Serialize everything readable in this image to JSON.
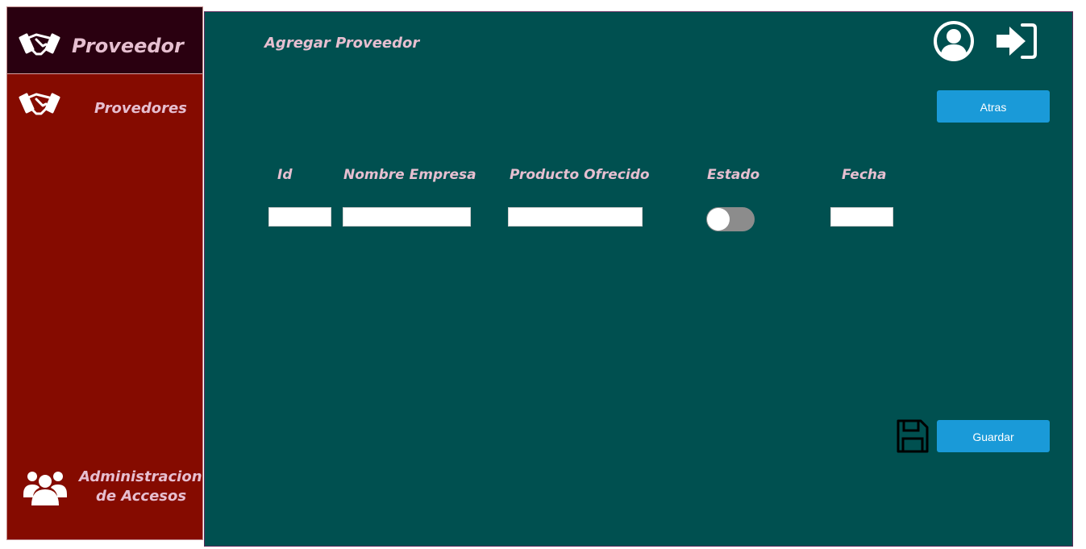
{
  "sidebar": {
    "title": "Proveedor",
    "items": [
      {
        "label": "Provedores",
        "icon": "handshake-icon"
      },
      {
        "label_line1": "Administracion",
        "label_line2": "de Accesos",
        "icon": "users-icon"
      }
    ]
  },
  "header": {
    "title": "Agregar Proveedor",
    "icons": [
      "user-avatar-icon",
      "sign-in-icon"
    ]
  },
  "buttons": {
    "back_label": "Atras",
    "save_label": "Guardar"
  },
  "form": {
    "columns": [
      "Id",
      "Nombre Empresa",
      "Producto Ofrecido",
      "Estado",
      "Fecha"
    ],
    "values": {
      "id": "",
      "nombre_empresa": "",
      "producto_ofrecido": "",
      "estado": false,
      "fecha": ""
    }
  },
  "colors": {
    "sidebar": "#850b00",
    "sidebar_header": "#2a0010",
    "main": "#005050",
    "accent_button": "#1a9ad8",
    "text": "#e6bfd0"
  }
}
